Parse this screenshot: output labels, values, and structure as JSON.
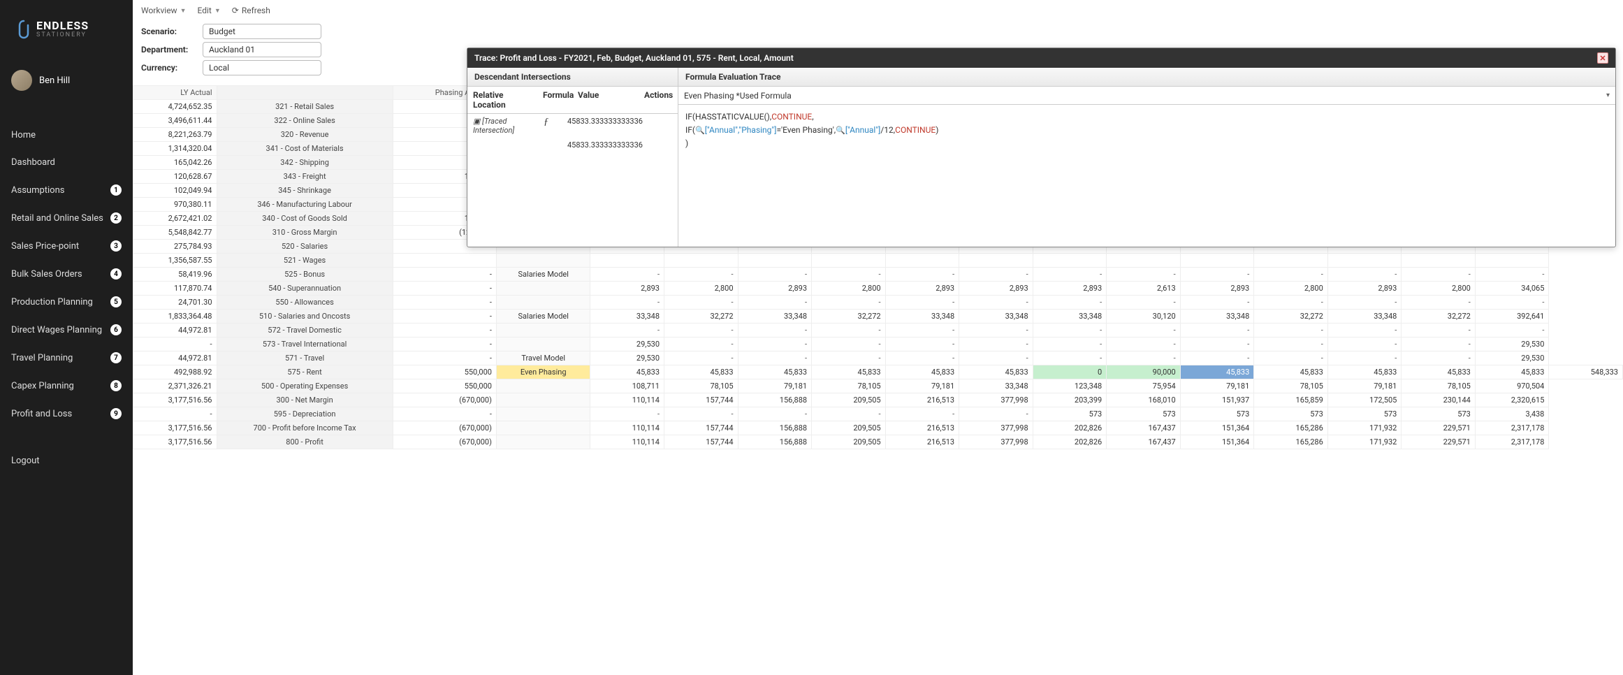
{
  "brand": {
    "name": "ENDLESS",
    "sub": "STATIONERY"
  },
  "user": {
    "name": "Ben Hill"
  },
  "nav": [
    {
      "label": "Home",
      "badge": null
    },
    {
      "label": "Dashboard",
      "badge": null
    },
    {
      "label": "Assumptions",
      "badge": "1"
    },
    {
      "label": "Retail and Online Sales",
      "badge": "2"
    },
    {
      "label": "Sales Price-point",
      "badge": "3"
    },
    {
      "label": "Bulk Sales Orders",
      "badge": "4"
    },
    {
      "label": "Production Planning",
      "badge": "5"
    },
    {
      "label": "Direct Wages Planning",
      "badge": "6"
    },
    {
      "label": "Travel Planning",
      "badge": "7"
    },
    {
      "label": "Capex Planning",
      "badge": "8"
    },
    {
      "label": "Profit and Loss",
      "badge": "9"
    },
    {
      "label": "Logout",
      "badge": null
    }
  ],
  "toolbar": {
    "workview": "Workview",
    "edit": "Edit",
    "refresh": "Refresh"
  },
  "filters": {
    "scenario_label": "Scenario:",
    "scenario_value": "Budget",
    "department_label": "Department:",
    "department_value": "Auckland 01",
    "currency_label": "Currency:",
    "currency_value": "Local"
  },
  "headers": {
    "ly": "LY Actual",
    "phasing": "Phasing Amount"
  },
  "rows": [
    {
      "ly": "4,724,652.35",
      "label": "321 - Retail Sales"
    },
    {
      "ly": "3,496,611.44",
      "label": "322 - Online Sales"
    },
    {
      "ly": "8,221,263.79",
      "label": "320 - Revenue"
    },
    {
      "ly": "1,314,320.04",
      "label": "341 - Cost of Materials"
    },
    {
      "ly": "165,042.26",
      "label": "342 - Shipping"
    },
    {
      "ly": "120,628.67",
      "label": "343 - Freight",
      "phasing": "120,000"
    },
    {
      "ly": "102,049.94",
      "label": "345 - Shrinkage"
    },
    {
      "ly": "970,380.11",
      "label": "346 - Manufacturing Labour"
    },
    {
      "ly": "2,672,421.02",
      "label": "340 - Cost of Goods Sold",
      "phasing": "120,000"
    },
    {
      "ly": "5,548,842.77",
      "label": "310 - Gross Margin",
      "phasing": "(120,000)"
    },
    {
      "ly": "275,784.93",
      "label": "520 - Salaries"
    },
    {
      "ly": "1,356,587.55",
      "label": "521 - Wages"
    },
    {
      "ly": "58,419.96",
      "label": "525 - Bonus",
      "phasing": "-",
      "model": "Salaries Model",
      "cells": [
        "-",
        "-",
        "-",
        "-",
        "-",
        "-",
        "-",
        "-",
        "-",
        "-",
        "-",
        "-",
        "-"
      ]
    },
    {
      "ly": "117,870.74",
      "label": "540 - Superannuation",
      "phasing": "-",
      "cells": [
        "2,893",
        "2,800",
        "2,893",
        "2,800",
        "2,893",
        "2,893",
        "2,893",
        "2,613",
        "2,893",
        "2,800",
        "2,893",
        "2,800",
        "34,065"
      ]
    },
    {
      "ly": "24,701.30",
      "label": "550 - Allowances",
      "phasing": "-",
      "cells": [
        "-",
        "-",
        "-",
        "-",
        "-",
        "-",
        "-",
        "-",
        "-",
        "-",
        "-",
        "-",
        "-"
      ]
    },
    {
      "ly": "1,833,364.48",
      "label": "510 - Salaries and Oncosts",
      "phasing": "-",
      "model": "Salaries Model",
      "cells": [
        "33,348",
        "32,272",
        "33,348",
        "32,272",
        "33,348",
        "33,348",
        "33,348",
        "30,120",
        "33,348",
        "32,272",
        "33,348",
        "32,272",
        "392,641"
      ]
    },
    {
      "ly": "44,972.81",
      "label": "572 - Travel Domestic",
      "phasing": "-",
      "cells": [
        "-",
        "-",
        "-",
        "-",
        "-",
        "-",
        "-",
        "-",
        "-",
        "-",
        "-",
        "-",
        "-"
      ]
    },
    {
      "ly": "-",
      "label": "573 - Travel International",
      "phasing": "-",
      "cells": [
        "29,530",
        "-",
        "-",
        "-",
        "-",
        "-",
        "-",
        "-",
        "-",
        "-",
        "-",
        "-",
        "29,530"
      ]
    },
    {
      "ly": "44,972.81",
      "label": "571 - Travel",
      "phasing": "-",
      "model": "Travel Model",
      "cells": [
        "29,530",
        "-",
        "-",
        "-",
        "-",
        "-",
        "-",
        "-",
        "-",
        "-",
        "-",
        "-",
        "29,530"
      ]
    },
    {
      "ly": "492,988.92",
      "label": "575 - Rent",
      "phasing": "550,000",
      "model": "Even Phasing",
      "modelClass": "cell-yellow",
      "cells": [
        "45,833",
        "45,833",
        "45,833",
        "45,833",
        "45,833",
        "45,833",
        "0",
        "90,000",
        "45,833",
        "45,833",
        "45,833",
        "45,833",
        "45,833",
        "548,333"
      ],
      "hl": {
        "6": "cell-green",
        "7": "cell-green",
        "8": "cell-blue"
      }
    },
    {
      "ly": "2,371,326.21",
      "label": "500 - Operating Expenses",
      "phasing": "550,000",
      "cells": [
        "108,711",
        "78,105",
        "79,181",
        "78,105",
        "79,181",
        "33,348",
        "123,348",
        "75,954",
        "79,181",
        "78,105",
        "79,181",
        "78,105",
        "970,504"
      ]
    },
    {
      "ly": "3,177,516.56",
      "label": "300 - Net Margin",
      "phasing": "(670,000)",
      "cells": [
        "110,114",
        "157,744",
        "156,888",
        "209,505",
        "216,513",
        "377,998",
        "203,399",
        "168,010",
        "151,937",
        "165,859",
        "172,505",
        "230,144",
        "2,320,615"
      ]
    },
    {
      "ly": "-",
      "label": "595 - Depreciation",
      "phasing": "-",
      "cells": [
        "-",
        "-",
        "-",
        "-",
        "-",
        "-",
        "573",
        "573",
        "573",
        "573",
        "573",
        "573",
        "3,438"
      ]
    },
    {
      "ly": "3,177,516.56",
      "label": "700 - Profit before Income Tax",
      "phasing": "(670,000)",
      "cells": [
        "110,114",
        "157,744",
        "156,888",
        "209,505",
        "216,513",
        "377,998",
        "202,826",
        "167,437",
        "151,364",
        "165,286",
        "171,932",
        "229,571",
        "2,317,178"
      ]
    },
    {
      "ly": "3,177,516.56",
      "label": "800 - Profit",
      "phasing": "(670,000)",
      "cells": [
        "110,114",
        "157,744",
        "156,888",
        "209,505",
        "216,513",
        "377,998",
        "202,826",
        "167,437",
        "151,364",
        "165,286",
        "171,932",
        "229,571",
        "2,317,178"
      ]
    }
  ],
  "dialog": {
    "title": "Trace: Profit and Loss - FY2021, Feb, Budget, Auckland 01, 575 - Rent, Local, Amount",
    "left_title": "Descendant Intersections",
    "right_title": "Formula Evaluation Trace",
    "cols": {
      "rel": "Relative Location",
      "formula": "Formula",
      "value": "Value",
      "actions": "Actions"
    },
    "row1_loc": "[Traced Intersection]",
    "row1_f": "ƒ",
    "row1_val": "45833.333333333336",
    "row2_val": "45833.333333333336",
    "formula_select": "Even Phasing *Used Formula",
    "formula_lines": [
      [
        {
          "t": "IF(HASSTATICVALUE(),"
        },
        {
          "t": "CONTINUE",
          "c": "kw-red"
        },
        {
          "t": ","
        }
      ],
      [
        {
          "t": "IF("
        },
        {
          "t": "🔍",
          "c": "mag"
        },
        {
          "t": "[\"Annual\",\"Phasing\"]",
          "c": "kw-blue"
        },
        {
          "t": "='Even Phasing',"
        },
        {
          "t": "🔍",
          "c": "mag"
        },
        {
          "t": "[\"Annual\"]",
          "c": "kw-blue"
        },
        {
          "t": "/12,"
        },
        {
          "t": "CONTINUE",
          "c": "kw-red"
        },
        {
          "t": ")"
        }
      ],
      [
        {
          "t": ")"
        }
      ]
    ]
  }
}
